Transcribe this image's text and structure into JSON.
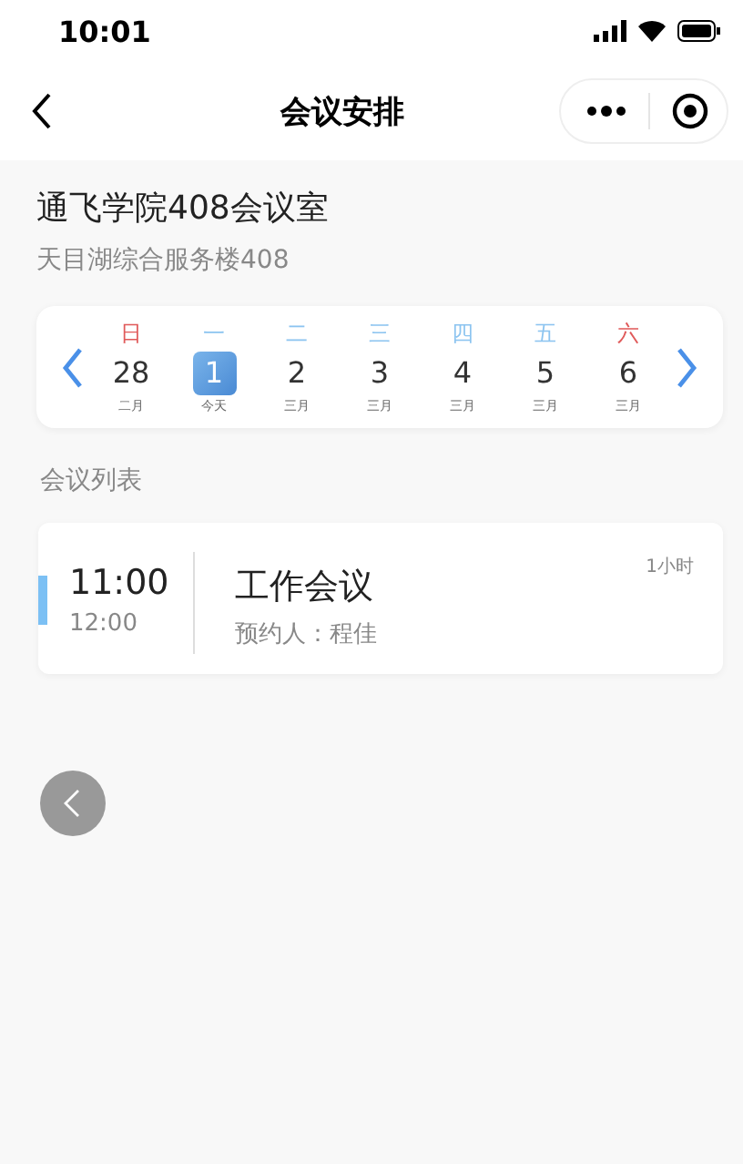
{
  "status_bar": {
    "time": "10:01"
  },
  "nav": {
    "title": "会议安排"
  },
  "room": {
    "name": "通飞学院408会议室",
    "location": "天目湖综合服务楼408"
  },
  "calendar": {
    "days": [
      {
        "weekday": "日",
        "date": "28",
        "month": "二月",
        "color": "#e05a5a",
        "selected": false
      },
      {
        "weekday": "一",
        "date": "1",
        "month": "今天",
        "color": "#8cc4f0",
        "selected": true
      },
      {
        "weekday": "二",
        "date": "2",
        "month": "三月",
        "color": "#8cc4f0",
        "selected": false
      },
      {
        "weekday": "三",
        "date": "3",
        "month": "三月",
        "color": "#8cc4f0",
        "selected": false
      },
      {
        "weekday": "四",
        "date": "4",
        "month": "三月",
        "color": "#8cc4f0",
        "selected": false
      },
      {
        "weekday": "五",
        "date": "5",
        "month": "三月",
        "color": "#8cc4f0",
        "selected": false
      },
      {
        "weekday": "六",
        "date": "6",
        "month": "三月",
        "color": "#e05a5a",
        "selected": false
      }
    ]
  },
  "section_title": "会议列表",
  "meetings": [
    {
      "start": "11:00",
      "end": "12:00",
      "title": "工作会议",
      "booker": "预约人：程佳",
      "duration": "1小时",
      "color": "#7cc0f4"
    }
  ]
}
